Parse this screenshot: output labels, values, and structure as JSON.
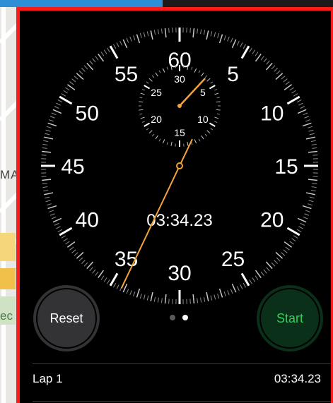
{
  "background": {
    "map_label_1": "MA",
    "map_label_2": "ec"
  },
  "stopwatch": {
    "dial_numbers": [
      "60",
      "5",
      "10",
      "15",
      "20",
      "25",
      "30",
      "35",
      "40",
      "45",
      "50",
      "55"
    ],
    "subdial_numbers": [
      "30",
      "5",
      "10",
      "15",
      "20",
      "25"
    ],
    "elapsed_display": "03:34.23",
    "hand_color": "#f2a33a",
    "elapsed_seconds": 34.23,
    "elapsed_minutes": 3.57
  },
  "controls": {
    "reset_label": "Reset",
    "start_label": "Start",
    "page_indicator": {
      "count": 2,
      "active": 1
    }
  },
  "laps": [
    {
      "name": "Lap 1",
      "time": "03:34.23"
    }
  ]
}
